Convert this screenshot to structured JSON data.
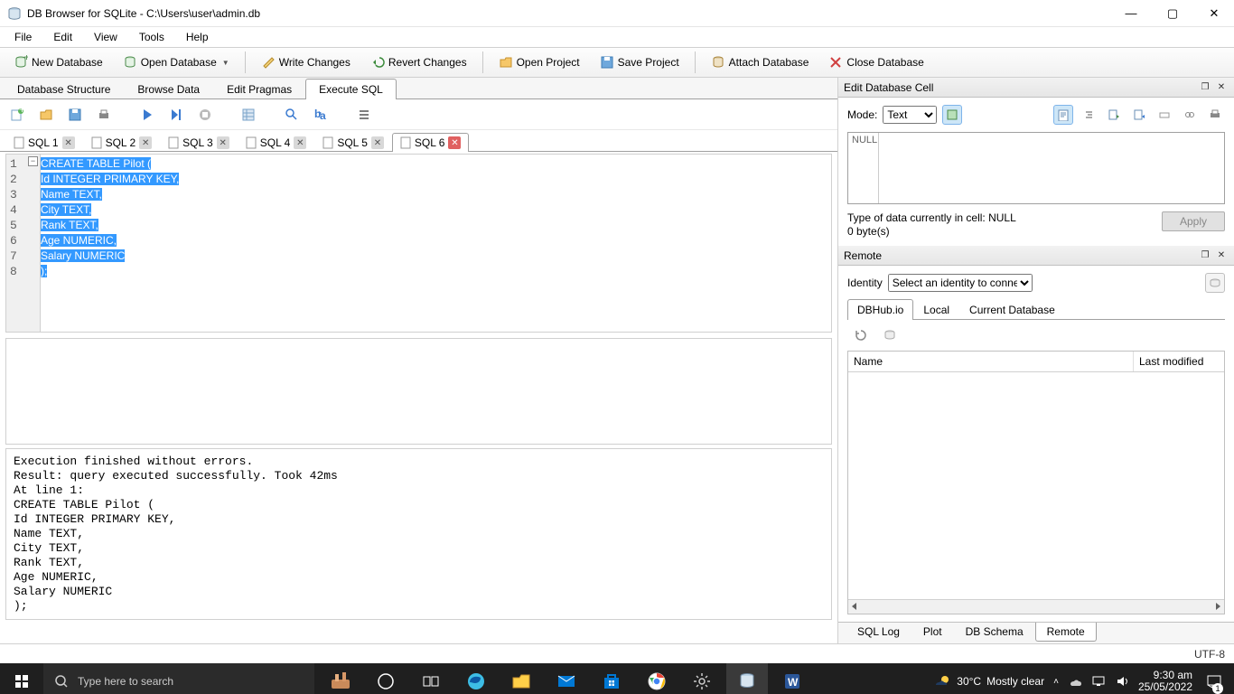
{
  "window": {
    "title": "DB Browser for SQLite - C:\\Users\\user\\admin.db"
  },
  "menubar": [
    "File",
    "Edit",
    "View",
    "Tools",
    "Help"
  ],
  "toolbar": {
    "new_db": "New Database",
    "open_db": "Open Database",
    "write_changes": "Write Changes",
    "revert_changes": "Revert Changes",
    "open_project": "Open Project",
    "save_project": "Save Project",
    "attach_db": "Attach Database",
    "close_db": "Close Database"
  },
  "main_tabs": {
    "structure": "Database Structure",
    "browse": "Browse Data",
    "pragmas": "Edit Pragmas",
    "execute": "Execute SQL"
  },
  "sql_tabs": [
    "SQL 1",
    "SQL 2",
    "SQL 3",
    "SQL 4",
    "SQL 5",
    "SQL 6"
  ],
  "sql_active_index": 5,
  "code_lines": [
    "CREATE TABLE Pilot (",
    "Id INTEGER PRIMARY KEY,",
    "Name TEXT,",
    "City TEXT,",
    "Rank TEXT,",
    "Age NUMERIC,",
    "Salary NUMERIC",
    ");"
  ],
  "output": "Execution finished without errors.\nResult: query executed successfully. Took 42ms\nAt line 1:\nCREATE TABLE Pilot (\nId INTEGER PRIMARY KEY,\nName TEXT,\nCity TEXT,\nRank TEXT,\nAge NUMERIC,\nSalary NUMERIC\n);",
  "cell_panel": {
    "title": "Edit Database Cell",
    "mode_label": "Mode:",
    "mode_value": "Text",
    "null_label": "NULL",
    "type_info": "Type of data currently in cell: NULL",
    "size_info": "0 byte(s)",
    "apply": "Apply"
  },
  "remote_panel": {
    "title": "Remote",
    "identity_label": "Identity",
    "identity_placeholder": "Select an identity to connect",
    "tabs": [
      "DBHub.io",
      "Local",
      "Current Database"
    ],
    "columns": {
      "name": "Name",
      "last_modified": "Last modified"
    }
  },
  "bottom_tabs": [
    "SQL Log",
    "Plot",
    "DB Schema",
    "Remote"
  ],
  "bottom_active_index": 3,
  "status": {
    "encoding": "UTF-8"
  },
  "taskbar": {
    "search_placeholder": "Type here to search",
    "weather_temp": "30°C",
    "weather_text": "Mostly clear",
    "time": "9:30 am",
    "date": "25/05/2022",
    "notif_count": "1"
  }
}
